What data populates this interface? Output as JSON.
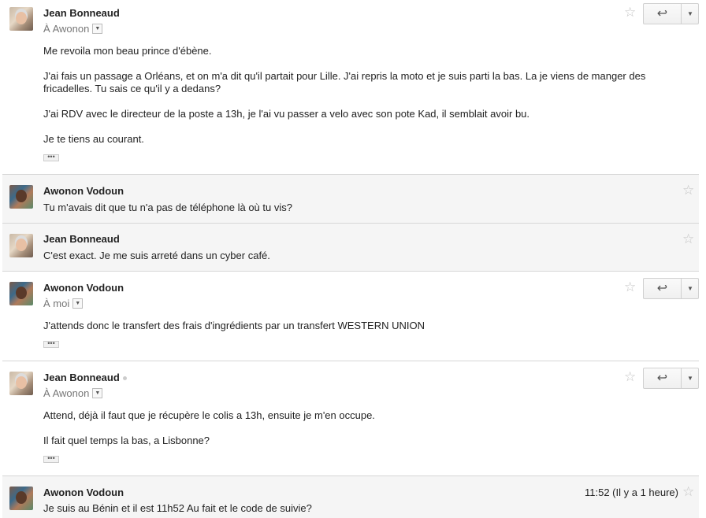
{
  "messages": [
    {
      "sender": "Jean Bonneaud",
      "to_label": "À Awonon",
      "body": [
        "Me revoila mon beau prince d'ébène.",
        "J'ai fais un passage a Orléans, et on m'a dit qu'il partait pour Lille. J'ai repris la moto et je suis parti la bas. La je viens de manger des fricadelles. Tu sais ce qu'il y a dedans?",
        "J'ai RDV avec le directeur de la poste a 13h, je l'ai vu passer a velo avec son pote Kad, il semblait avoir bu.",
        "Je te tiens au courant."
      ],
      "ellipsis": "•••"
    },
    {
      "sender": "Awonon Vodoun",
      "snippet": "Tu m'avais dit que tu n'a pas de téléphone là où tu vis?"
    },
    {
      "sender": "Jean Bonneaud",
      "snippet": "C'est exact. Je me suis arreté dans un cyber café."
    },
    {
      "sender": "Awonon Vodoun",
      "to_label": "À moi",
      "body": [
        "J'attends donc le transfert des frais d'ingrédients par un transfert WESTERN UNION"
      ],
      "ellipsis": "•••"
    },
    {
      "sender": "Jean Bonneaud",
      "to_label": "À Awonon",
      "body": [
        "Attend, déjà il faut que je récupère le colis a 13h, ensuite je m'en occupe.",
        "Il fait quel temps la bas, a Lisbonne?"
      ],
      "ellipsis": "•••"
    },
    {
      "sender": "Awonon Vodoun",
      "snippet": "Je suis au Bénin et il est 11h52 Au fait et le code de suivie?",
      "time": "11:52 (Il y a 1 heure)"
    }
  ],
  "icons": {
    "star": "☆",
    "reply": "↩",
    "dropdown": "▼"
  },
  "colors": {
    "collapsed_bg": "#f5f5f5",
    "divider": "#d6d6d6",
    "star": "#c4c4c4"
  }
}
